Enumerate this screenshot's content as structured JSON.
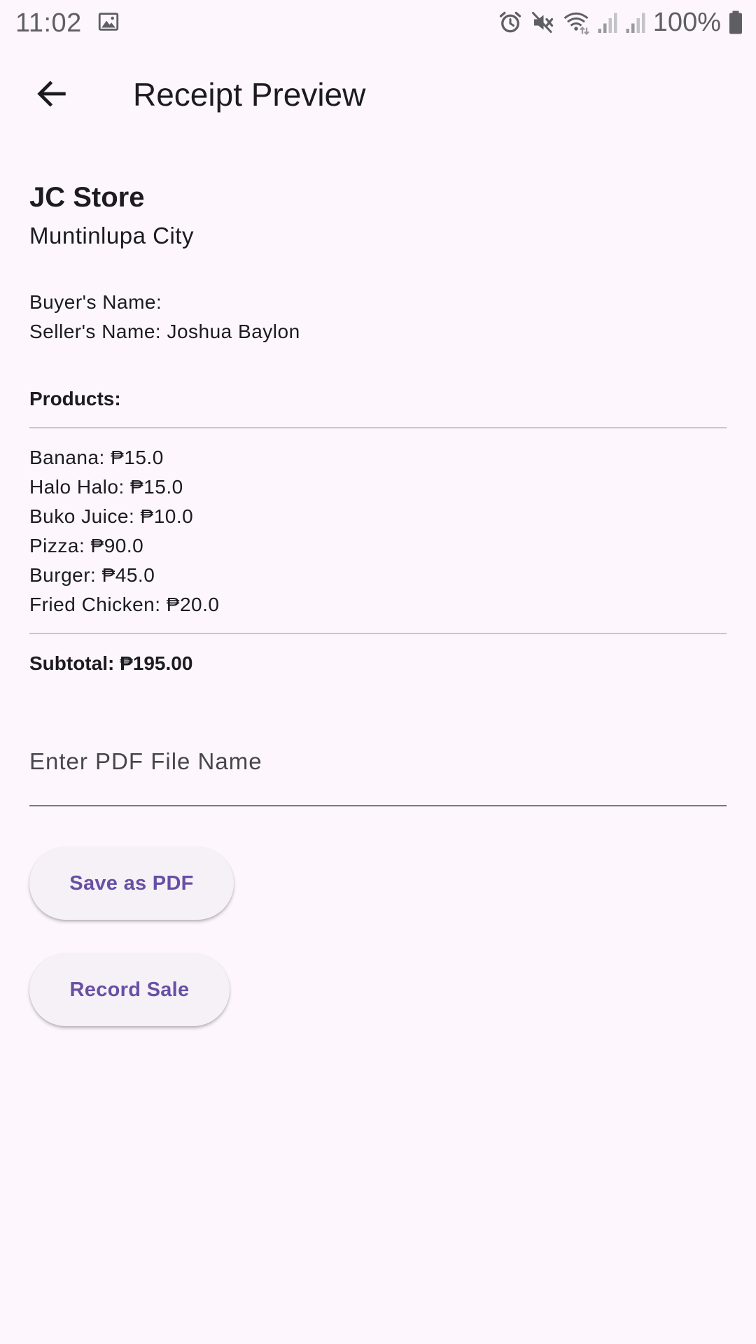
{
  "status_bar": {
    "time": "11:02",
    "battery": "100%",
    "left_icons": [
      "gallery-icon"
    ],
    "right_icons": [
      "alarm-icon",
      "mute-icon",
      "wifi-icon",
      "signal-icon",
      "signal-icon",
      "battery-icon"
    ]
  },
  "app_bar": {
    "title": "Receipt Preview",
    "back_icon": "arrow-back-icon"
  },
  "store": {
    "name": "JC Store",
    "city": "Muntinlupa City"
  },
  "buyer_line": "Buyer's Name:",
  "seller_line": "Seller's Name: Joshua Baylon",
  "products_heading": "Products:",
  "products": [
    "Banana: ₱15.0",
    "Halo Halo: ₱15.0",
    "Buko Juice: ₱10.0",
    "Pizza: ₱90.0",
    "Burger: ₱45.0",
    "Fried Chicken: ₱20.0"
  ],
  "subtotal": "Subtotal: ₱195.00",
  "pdf_input": {
    "placeholder": "Enter PDF File Name",
    "value": ""
  },
  "buttons": {
    "save_pdf": "Save as PDF",
    "record_sale": "Record Sale"
  },
  "colors": {
    "background": "#fdf7fd",
    "accent": "#6750a4",
    "button_bg": "#f6f1f7",
    "divider": "#c9c5cb"
  }
}
